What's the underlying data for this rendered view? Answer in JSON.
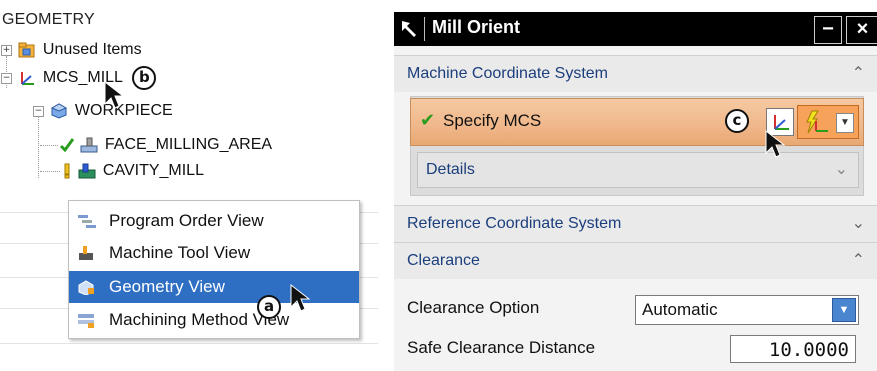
{
  "navigator": {
    "header": "GEOMETRY",
    "nodes": [
      {
        "label": "Unused Items",
        "expander": "+"
      },
      {
        "label": "MCS_MILL",
        "expander": "−"
      },
      {
        "label": "WORKPIECE",
        "expander": "−"
      },
      {
        "label": "FACE_MILLING_AREA"
      },
      {
        "label": "CAVITY_MILL"
      }
    ],
    "callouts": {
      "b": "b",
      "a": "a"
    }
  },
  "context_menu": {
    "items": [
      {
        "label": "Program Order View",
        "icon": "program-order-icon"
      },
      {
        "label": "Machine Tool View",
        "icon": "machine-tool-icon"
      },
      {
        "label": "Geometry View",
        "icon": "geometry-view-icon",
        "selected": true
      },
      {
        "label": "Machining Method View",
        "icon": "machining-method-icon"
      }
    ]
  },
  "dialog": {
    "title": "Mill Orient",
    "buttons": {
      "minimize": "−",
      "close": "×"
    },
    "sections": {
      "mcs": "Machine Coordinate System",
      "reference": "Reference Coordinate System",
      "clearance": "Clearance"
    },
    "specify": {
      "label": "Specify MCS",
      "callout": "c"
    },
    "details": "Details",
    "clearance_option": {
      "label": "Clearance Option",
      "value": "Automatic"
    },
    "safe_distance": {
      "label": "Safe Clearance Distance",
      "value": "10.0000"
    }
  },
  "colors": {
    "selection": "#2e6fc4",
    "section_text": "#1b3e7d",
    "specify_bg": "#f0b78a",
    "check": "#2a9d1f"
  }
}
